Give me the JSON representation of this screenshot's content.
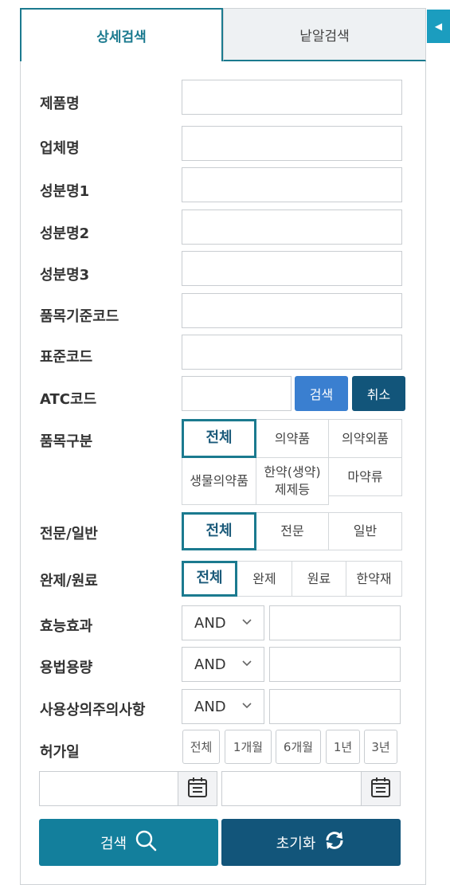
{
  "tabs": {
    "detail": "상세검색",
    "letter": "낱알검색"
  },
  "collapse_icon": "◀",
  "fields": {
    "product_name": "제품명",
    "company_name": "업체명",
    "ingredient1": "성분명1",
    "ingredient2": "성분명2",
    "ingredient3": "성분명3",
    "item_standard_code": "품목기준코드",
    "standard_code": "표준코드",
    "atc_code": "ATC코드"
  },
  "atc_buttons": {
    "search": "검색",
    "cancel": "취소"
  },
  "item_category": {
    "label": "품목구분",
    "options": [
      "전체",
      "의약품",
      "의약외품",
      "생물의약품",
      "한약(생약)제제등",
      "마약류"
    ],
    "selected": "전체"
  },
  "prescription_type": {
    "label": "전문/일반",
    "options": [
      "전체",
      "전문",
      "일반"
    ],
    "selected": "전체"
  },
  "product_type": {
    "label": "완제/원료",
    "options": [
      "전체",
      "완제",
      "원료",
      "한약재"
    ],
    "selected": "전체"
  },
  "effect": {
    "label": "효능효과",
    "operator": "AND"
  },
  "dosage": {
    "label": "용법용량",
    "operator": "AND"
  },
  "precautions": {
    "label": "사용상의주의사항",
    "operator": "AND"
  },
  "approval_date": {
    "label": "허가일",
    "periods": [
      "전체",
      "1개월",
      "6개월",
      "1년",
      "3년"
    ]
  },
  "actions": {
    "search": "검색",
    "reset": "초기화"
  },
  "colors": {
    "accent": "#1b7a8f",
    "search_blue": "#3a7fd0",
    "dark_navy": "#12557a",
    "teal_button": "#137f9c",
    "collapse_blue": "#1b9dbf"
  }
}
